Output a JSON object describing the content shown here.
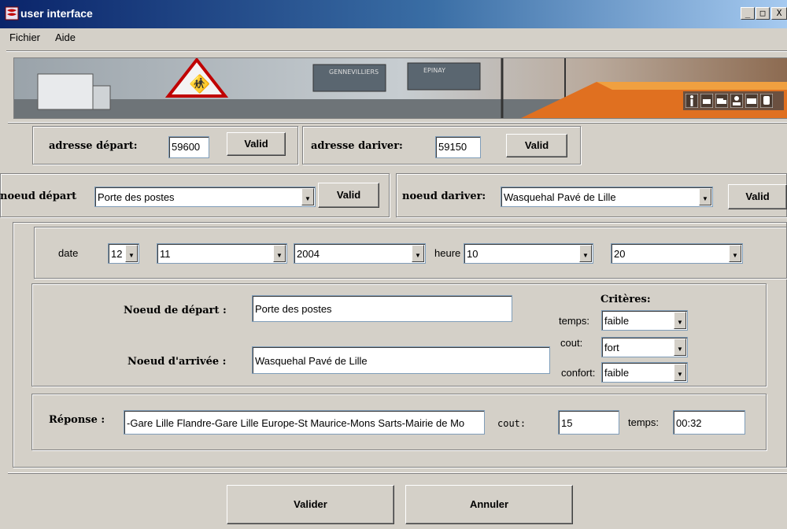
{
  "window": {
    "title": "user interface",
    "min": "_",
    "max": "□",
    "close": "X"
  },
  "menu": [
    "Fichier",
    "Aide"
  ],
  "address": {
    "depart_label": "adresse départ:",
    "depart_value": "59600",
    "depart_btn": "Valid",
    "arrivee_label": "adresse dariver:",
    "arrivee_value": "59150",
    "arrivee_btn": "Valid"
  },
  "nodes": {
    "depart_label": "noeud départ",
    "depart_value": "Porte des postes",
    "depart_btn": "Valid",
    "arrivee_label": "noeud dariver:",
    "arrivee_value": "Wasquehal Pavé de Lille",
    "arrivee_btn": "Valid"
  },
  "datetime": {
    "date_label": "date",
    "day": "12",
    "month": "11",
    "year": "2004",
    "heure_label": "heure",
    "hour": "10",
    "minute": "20"
  },
  "summary": {
    "depart_label": "Noeud de départ :",
    "depart_value": "Porte des postes",
    "arrivee_label": "Noeud d'arrivée :",
    "arrivee_value": "Wasquehal Pavé de Lille",
    "criteria_title": "Critères:",
    "temps_label": "temps:",
    "temps_value": "faible",
    "cout_label": "cout:",
    "cout_value": "fort",
    "confort_label": "confort:",
    "confort_value": "faible"
  },
  "response": {
    "label": "Réponse :",
    "value": "-Gare Lille Flandre-Gare Lille Europe-St Maurice-Mons Sarts-Mairie de Mo",
    "cout_label": "cout:",
    "cout_value": "15",
    "temps_label": "temps:",
    "temps_value": "00:32"
  },
  "actions": {
    "valider": "Valider",
    "annuler": "Annuler"
  },
  "colors": {
    "titlebar_start": "#0a246a",
    "titlebar_end": "#a6caf0",
    "window_bg": "#d4d0c8"
  },
  "icons": [
    "app-icon",
    "pedestrian-icon",
    "car-icon",
    "truck-icon",
    "person-icon",
    "bus-icon",
    "train-icon",
    "chevron-down-icon"
  ]
}
